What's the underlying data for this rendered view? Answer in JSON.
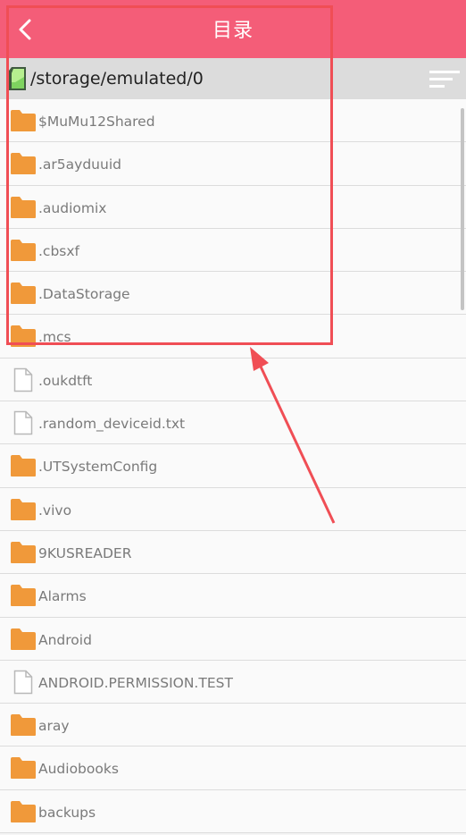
{
  "header": {
    "title": "目录",
    "back_icon": "chevron-left-icon"
  },
  "pathbar": {
    "path": "/storage/emulated/0",
    "sd_icon": "sd-card-icon",
    "sort_icon": "sort-icon"
  },
  "files": [
    {
      "name": "$MuMu12Shared",
      "type": "folder"
    },
    {
      "name": ".ar5ayduuid",
      "type": "folder"
    },
    {
      "name": ".audiomix",
      "type": "folder"
    },
    {
      "name": ".cbsxf",
      "type": "folder"
    },
    {
      "name": ".DataStorage",
      "type": "folder"
    },
    {
      "name": ".mcs",
      "type": "folder"
    },
    {
      "name": ".oukdtft",
      "type": "file"
    },
    {
      "name": ".random_deviceid.txt",
      "type": "file"
    },
    {
      "name": ".UTSystemConfig",
      "type": "folder"
    },
    {
      "name": ".vivo",
      "type": "folder"
    },
    {
      "name": "9KUSREADER",
      "type": "folder"
    },
    {
      "name": "Alarms",
      "type": "folder"
    },
    {
      "name": "Android",
      "type": "folder"
    },
    {
      "name": "ANDROID.PERMISSION.TEST",
      "type": "file"
    },
    {
      "name": "aray",
      "type": "folder"
    },
    {
      "name": "Audiobooks",
      "type": "folder"
    },
    {
      "name": "backups",
      "type": "folder"
    }
  ],
  "colors": {
    "header": "#f45d78",
    "folder": "#f0993a",
    "annotation": "#f04e55"
  }
}
